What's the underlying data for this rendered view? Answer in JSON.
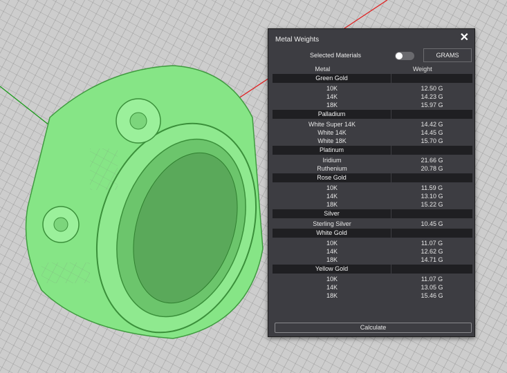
{
  "panel": {
    "title": "Metal Weights",
    "selected_materials_label": "Selected Materials",
    "unit_button": "GRAMS",
    "column_metal": "Metal",
    "column_weight": "Weight",
    "calculate_label": "Calculate"
  },
  "groups": [
    {
      "name": "Green Gold",
      "rows": [
        {
          "metal": "10K",
          "weight": "12.50 G"
        },
        {
          "metal": "14K",
          "weight": "14.23 G"
        },
        {
          "metal": "18K",
          "weight": "15.97 G"
        }
      ]
    },
    {
      "name": "Palladium",
      "rows": [
        {
          "metal": "White Super 14K",
          "weight": "14.42 G"
        },
        {
          "metal": "White 14K",
          "weight": "14.45 G"
        },
        {
          "metal": "White 18K",
          "weight": "15.70 G"
        }
      ]
    },
    {
      "name": "Platinum",
      "rows": [
        {
          "metal": "Iridium",
          "weight": "21.66 G"
        },
        {
          "metal": "Ruthenium",
          "weight": "20.78 G"
        }
      ]
    },
    {
      "name": "Rose Gold",
      "rows": [
        {
          "metal": "10K",
          "weight": "11.59 G"
        },
        {
          "metal": "14K",
          "weight": "13.10 G"
        },
        {
          "metal": "18K",
          "weight": "15.22 G"
        }
      ]
    },
    {
      "name": "Silver",
      "rows": [
        {
          "metal": "Sterling Silver",
          "weight": "10.45 G"
        }
      ]
    },
    {
      "name": "White Gold",
      "rows": [
        {
          "metal": "10K",
          "weight": "11.07 G"
        },
        {
          "metal": "14K",
          "weight": "12.62 G"
        },
        {
          "metal": "18K",
          "weight": "14.71 G"
        }
      ]
    },
    {
      "name": "Yellow Gold",
      "rows": [
        {
          "metal": "10K",
          "weight": "11.07 G"
        },
        {
          "metal": "14K",
          "weight": "13.05 G"
        },
        {
          "metal": "18K",
          "weight": "15.46 G"
        }
      ]
    }
  ],
  "colors": {
    "panel_bg": "#3d3d42",
    "group_bg": "#1f1f22",
    "ring_green": "#7ee27e",
    "axis_red": "#e02020",
    "axis_green": "#1a9a1a"
  },
  "toggle_on": false
}
